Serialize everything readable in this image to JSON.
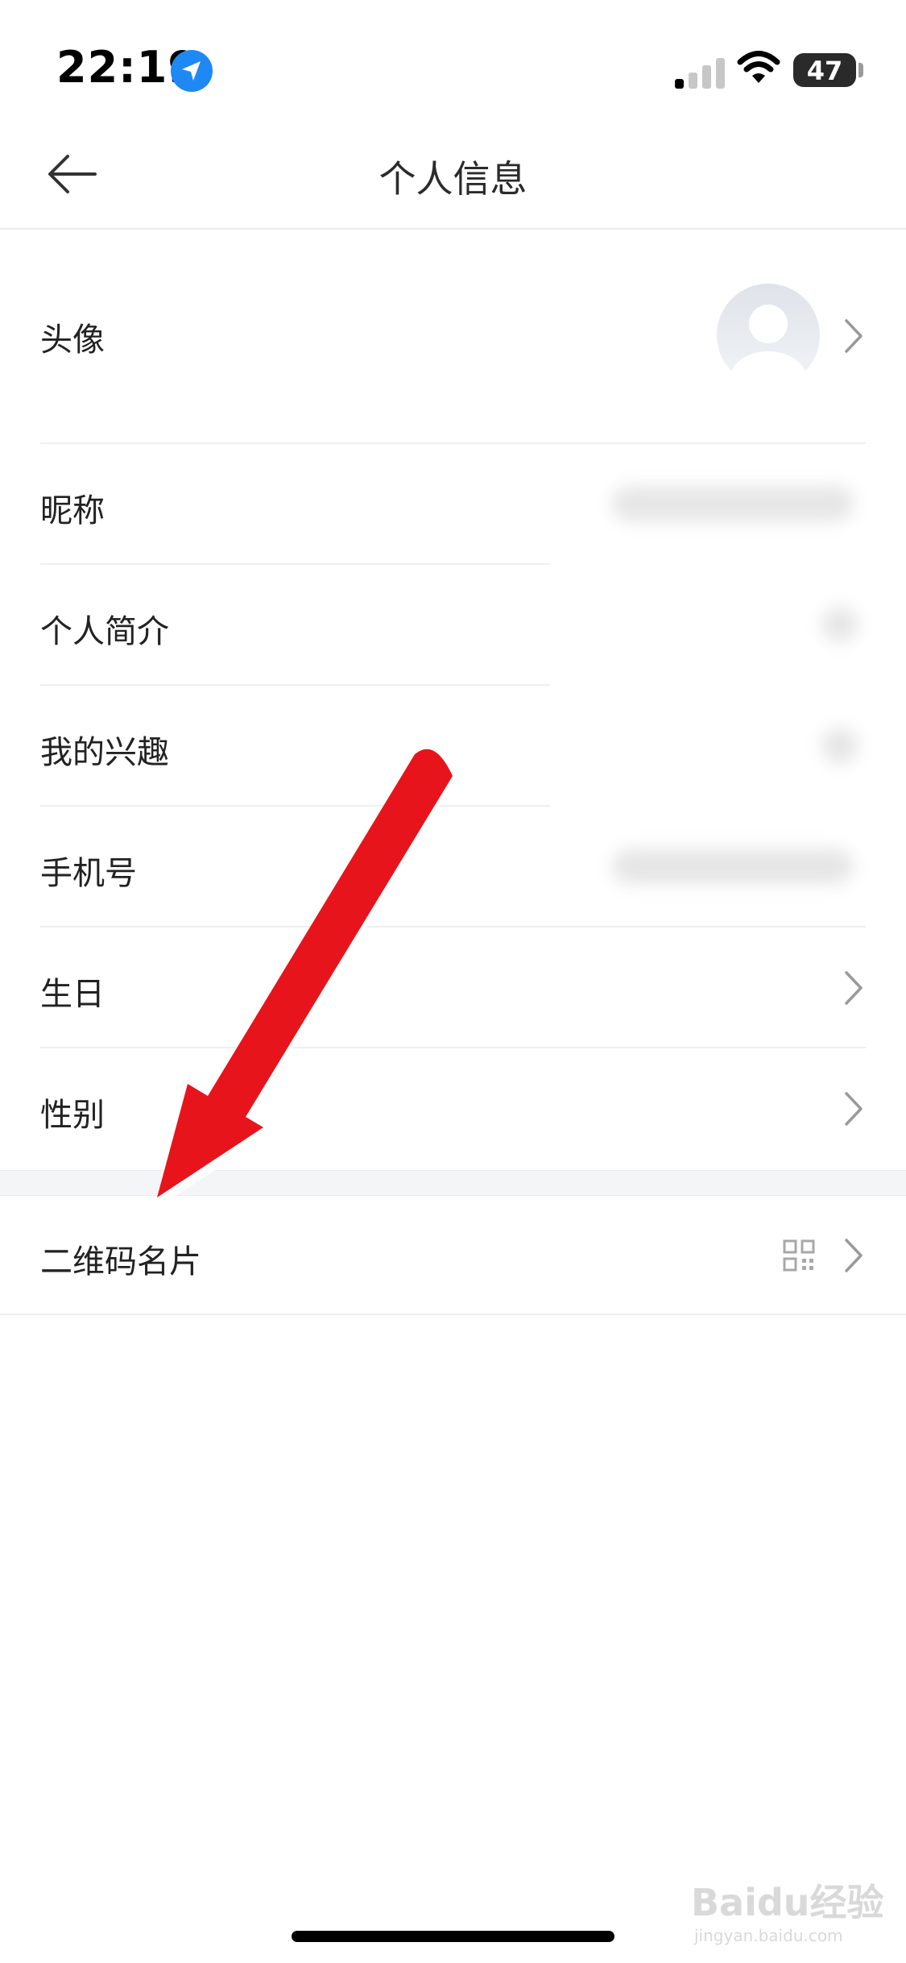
{
  "status_bar": {
    "time": "22:19",
    "battery": "47",
    "icons": [
      "location-icon",
      "signal-icon",
      "wifi-icon",
      "battery-icon"
    ]
  },
  "nav": {
    "title": "个人信息",
    "back_icon": "back-arrow-icon"
  },
  "rows": [
    {
      "label": "头像"
    },
    {
      "label": "昵称"
    },
    {
      "label": "个人简介"
    },
    {
      "label": "我的兴趣"
    },
    {
      "label": "手机号"
    },
    {
      "label": "生日"
    },
    {
      "label": "性别"
    },
    {
      "label": "二维码名片"
    }
  ],
  "watermark": {
    "text": "Baidu经验",
    "sub": "jingyan.baidu.com"
  },
  "colors": {
    "annotation_arrow": "#e8141b",
    "location_badge": "#1e88f5",
    "section_gap": "#f4f5f7"
  }
}
